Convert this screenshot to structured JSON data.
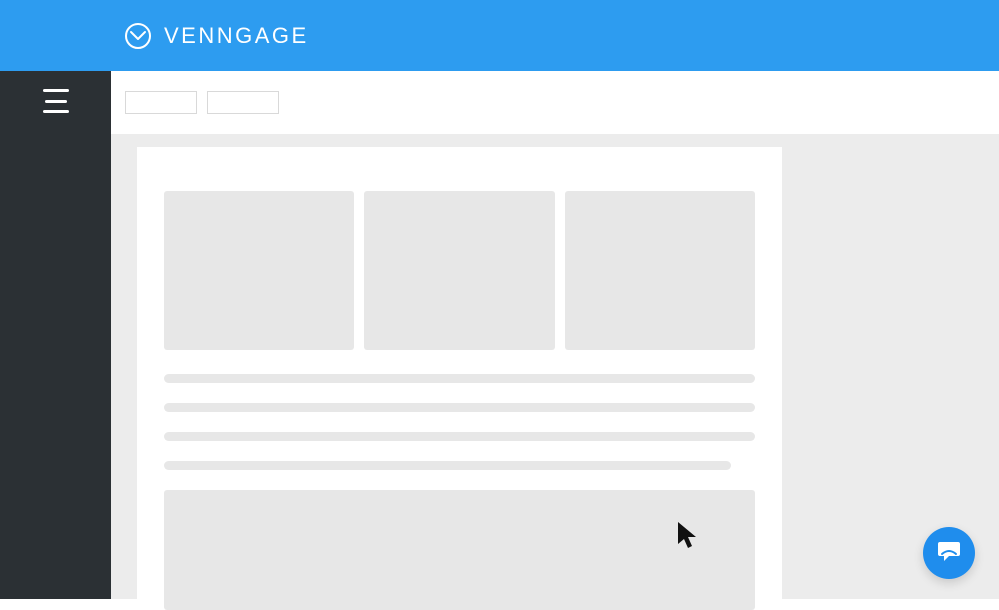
{
  "header": {
    "brand_label": "VENNGAGE"
  }
}
